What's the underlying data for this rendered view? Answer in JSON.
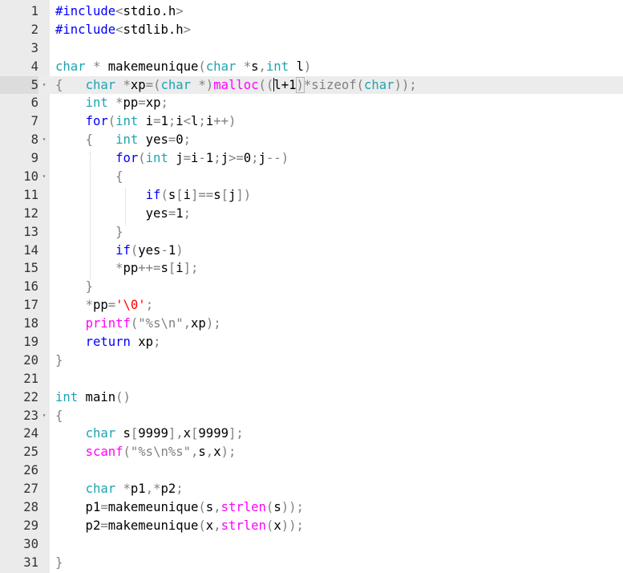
{
  "editor": {
    "active_line": 5,
    "colors": {
      "keyword": "#0000ff",
      "type": "#1ea3b3",
      "function": "#ff00ff",
      "punctuation": "#808080",
      "string_char": "#ff0000",
      "gutter_bg": "#ebebeb",
      "active_line_bg": "#ececec"
    },
    "lines": [
      {
        "num": "1",
        "fold": "",
        "tokens": [
          [
            "pre",
            "#include"
          ],
          [
            "punc",
            "<"
          ],
          [
            "text",
            "stdio.h"
          ],
          [
            "punc",
            ">"
          ]
        ]
      },
      {
        "num": "2",
        "fold": "",
        "tokens": [
          [
            "pre",
            "#include"
          ],
          [
            "punc",
            "<"
          ],
          [
            "text",
            "stdlib.h"
          ],
          [
            "punc",
            ">"
          ]
        ]
      },
      {
        "num": "3",
        "fold": "",
        "tokens": []
      },
      {
        "num": "4",
        "fold": "",
        "tokens": [
          [
            "type",
            "char"
          ],
          [
            "text",
            " "
          ],
          [
            "punc",
            "*"
          ],
          [
            "text",
            " makemeunique"
          ],
          [
            "punc",
            "("
          ],
          [
            "type",
            "char"
          ],
          [
            "text",
            " "
          ],
          [
            "punc",
            "*"
          ],
          [
            "text",
            "s"
          ],
          [
            "punc",
            ","
          ],
          [
            "type",
            "int"
          ],
          [
            "text",
            " l"
          ],
          [
            "punc",
            ")"
          ]
        ]
      },
      {
        "num": "5",
        "fold": "▾",
        "tokens": [
          [
            "punc",
            "{"
          ],
          [
            "text",
            "   "
          ],
          [
            "type",
            "char"
          ],
          [
            "text",
            " "
          ],
          [
            "punc",
            "*"
          ],
          [
            "text",
            "xp"
          ],
          [
            "punc",
            "=("
          ],
          [
            "type",
            "char"
          ],
          [
            "text",
            " "
          ],
          [
            "punc",
            "*)"
          ],
          [
            "func",
            "malloc"
          ],
          [
            "punc",
            "(("
          ],
          [
            "cursor",
            ""
          ],
          [
            "text",
            "l+1"
          ],
          [
            "bracket",
            ")"
          ],
          [
            "punc",
            "*"
          ],
          [
            "strgray",
            "sizeof"
          ],
          [
            "punc",
            "("
          ],
          [
            "type",
            "char"
          ],
          [
            "punc",
            "));"
          ]
        ]
      },
      {
        "num": "6",
        "fold": "",
        "tokens": [
          [
            "text",
            "    "
          ],
          [
            "type",
            "int"
          ],
          [
            "text",
            " "
          ],
          [
            "punc",
            "*"
          ],
          [
            "text",
            "pp"
          ],
          [
            "punc",
            "="
          ],
          [
            "text",
            "xp"
          ],
          [
            "punc",
            ";"
          ]
        ]
      },
      {
        "num": "7",
        "fold": "",
        "tokens": [
          [
            "text",
            "    "
          ],
          [
            "keyword",
            "for"
          ],
          [
            "punc",
            "("
          ],
          [
            "type",
            "int"
          ],
          [
            "text",
            " i"
          ],
          [
            "punc",
            "="
          ],
          [
            "text",
            "1"
          ],
          [
            "punc",
            ";"
          ],
          [
            "text",
            "i"
          ],
          [
            "punc",
            "<"
          ],
          [
            "text",
            "l"
          ],
          [
            "punc",
            ";"
          ],
          [
            "text",
            "i"
          ],
          [
            "punc",
            "++)"
          ]
        ]
      },
      {
        "num": "8",
        "fold": "▾",
        "tokens": [
          [
            "text",
            "    "
          ],
          [
            "punc",
            "{"
          ],
          [
            "text",
            "   "
          ],
          [
            "type",
            "int"
          ],
          [
            "text",
            " yes"
          ],
          [
            "punc",
            "="
          ],
          [
            "text",
            "0"
          ],
          [
            "punc",
            ";"
          ]
        ]
      },
      {
        "num": "9",
        "fold": "",
        "tokens": [
          [
            "text",
            "        "
          ],
          [
            "keyword",
            "for"
          ],
          [
            "punc",
            "("
          ],
          [
            "type",
            "int"
          ],
          [
            "text",
            " j"
          ],
          [
            "punc",
            "="
          ],
          [
            "text",
            "i"
          ],
          [
            "punc",
            "-"
          ],
          [
            "text",
            "1"
          ],
          [
            "punc",
            ";"
          ],
          [
            "text",
            "j"
          ],
          [
            "punc",
            ">="
          ],
          [
            "text",
            "0"
          ],
          [
            "punc",
            ";"
          ],
          [
            "text",
            "j"
          ],
          [
            "punc",
            "--)"
          ]
        ]
      },
      {
        "num": "10",
        "fold": "▾",
        "tokens": [
          [
            "text",
            "        "
          ],
          [
            "punc",
            "{"
          ]
        ]
      },
      {
        "num": "11",
        "fold": "",
        "tokens": [
          [
            "text",
            "            "
          ],
          [
            "keyword",
            "if"
          ],
          [
            "punc",
            "("
          ],
          [
            "text",
            "s"
          ],
          [
            "punc",
            "["
          ],
          [
            "text",
            "i"
          ],
          [
            "punc",
            "]=="
          ],
          [
            "text",
            "s"
          ],
          [
            "punc",
            "["
          ],
          [
            "text",
            "j"
          ],
          [
            "punc",
            "])"
          ]
        ]
      },
      {
        "num": "12",
        "fold": "",
        "tokens": [
          [
            "text",
            "            yes"
          ],
          [
            "punc",
            "="
          ],
          [
            "text",
            "1"
          ],
          [
            "punc",
            ";"
          ]
        ]
      },
      {
        "num": "13",
        "fold": "",
        "tokens": [
          [
            "text",
            "        "
          ],
          [
            "punc",
            "}"
          ]
        ]
      },
      {
        "num": "14",
        "fold": "",
        "tokens": [
          [
            "text",
            "        "
          ],
          [
            "keyword",
            "if"
          ],
          [
            "punc",
            "("
          ],
          [
            "text",
            "yes"
          ],
          [
            "punc",
            "-"
          ],
          [
            "text",
            "1"
          ],
          [
            "punc",
            ")"
          ]
        ]
      },
      {
        "num": "15",
        "fold": "",
        "tokens": [
          [
            "text",
            "        "
          ],
          [
            "punc",
            "*"
          ],
          [
            "text",
            "pp"
          ],
          [
            "punc",
            "++="
          ],
          [
            "text",
            "s"
          ],
          [
            "punc",
            "["
          ],
          [
            "text",
            "i"
          ],
          [
            "punc",
            "];"
          ]
        ]
      },
      {
        "num": "16",
        "fold": "",
        "tokens": [
          [
            "text",
            "    "
          ],
          [
            "punc",
            "}"
          ]
        ]
      },
      {
        "num": "17",
        "fold": "",
        "tokens": [
          [
            "text",
            "    "
          ],
          [
            "punc",
            "*"
          ],
          [
            "text",
            "pp"
          ],
          [
            "punc",
            "="
          ],
          [
            "string",
            "'\\0'"
          ],
          [
            "punc",
            ";"
          ]
        ]
      },
      {
        "num": "18",
        "fold": "",
        "tokens": [
          [
            "text",
            "    "
          ],
          [
            "func",
            "printf"
          ],
          [
            "punc",
            "("
          ],
          [
            "strgray",
            "\"%s\\n\""
          ],
          [
            "punc",
            ","
          ],
          [
            "text",
            "xp"
          ],
          [
            "punc",
            ");"
          ]
        ]
      },
      {
        "num": "19",
        "fold": "",
        "tokens": [
          [
            "text",
            "    "
          ],
          [
            "keyword",
            "return"
          ],
          [
            "text",
            " xp"
          ],
          [
            "punc",
            ";"
          ]
        ]
      },
      {
        "num": "20",
        "fold": "",
        "tokens": [
          [
            "punc",
            "}"
          ]
        ]
      },
      {
        "num": "21",
        "fold": "",
        "tokens": []
      },
      {
        "num": "22",
        "fold": "",
        "tokens": [
          [
            "type",
            "int"
          ],
          [
            "text",
            " main"
          ],
          [
            "punc",
            "()"
          ]
        ]
      },
      {
        "num": "23",
        "fold": "▾",
        "tokens": [
          [
            "punc",
            "{"
          ]
        ]
      },
      {
        "num": "24",
        "fold": "",
        "tokens": [
          [
            "text",
            "    "
          ],
          [
            "type",
            "char"
          ],
          [
            "text",
            " s"
          ],
          [
            "punc",
            "["
          ],
          [
            "text",
            "9999"
          ],
          [
            "punc",
            "],"
          ],
          [
            "text",
            "x"
          ],
          [
            "punc",
            "["
          ],
          [
            "text",
            "9999"
          ],
          [
            "punc",
            "];"
          ]
        ]
      },
      {
        "num": "25",
        "fold": "",
        "tokens": [
          [
            "text",
            "    "
          ],
          [
            "func",
            "scanf"
          ],
          [
            "punc",
            "("
          ],
          [
            "strgray",
            "\"%s\\n%s\""
          ],
          [
            "punc",
            ","
          ],
          [
            "text",
            "s"
          ],
          [
            "punc",
            ","
          ],
          [
            "text",
            "x"
          ],
          [
            "punc",
            ");"
          ]
        ]
      },
      {
        "num": "26",
        "fold": "",
        "tokens": []
      },
      {
        "num": "27",
        "fold": "",
        "tokens": [
          [
            "text",
            "    "
          ],
          [
            "type",
            "char"
          ],
          [
            "text",
            " "
          ],
          [
            "punc",
            "*"
          ],
          [
            "text",
            "p1"
          ],
          [
            "punc",
            ",*"
          ],
          [
            "text",
            "p2"
          ],
          [
            "punc",
            ";"
          ]
        ]
      },
      {
        "num": "28",
        "fold": "",
        "tokens": [
          [
            "text",
            "    p1"
          ],
          [
            "punc",
            "="
          ],
          [
            "text",
            "makemeunique"
          ],
          [
            "punc",
            "("
          ],
          [
            "text",
            "s"
          ],
          [
            "punc",
            ","
          ],
          [
            "func",
            "strlen"
          ],
          [
            "punc",
            "("
          ],
          [
            "text",
            "s"
          ],
          [
            "punc",
            "));"
          ]
        ]
      },
      {
        "num": "29",
        "fold": "",
        "tokens": [
          [
            "text",
            "    p2"
          ],
          [
            "punc",
            "="
          ],
          [
            "text",
            "makemeunique"
          ],
          [
            "punc",
            "("
          ],
          [
            "text",
            "x"
          ],
          [
            "punc",
            ","
          ],
          [
            "func",
            "strlen"
          ],
          [
            "punc",
            "("
          ],
          [
            "text",
            "x"
          ],
          [
            "punc",
            "));"
          ]
        ]
      },
      {
        "num": "30",
        "fold": "",
        "tokens": []
      },
      {
        "num": "31",
        "fold": "",
        "tokens": [
          [
            "punc",
            "}"
          ]
        ]
      }
    ]
  }
}
